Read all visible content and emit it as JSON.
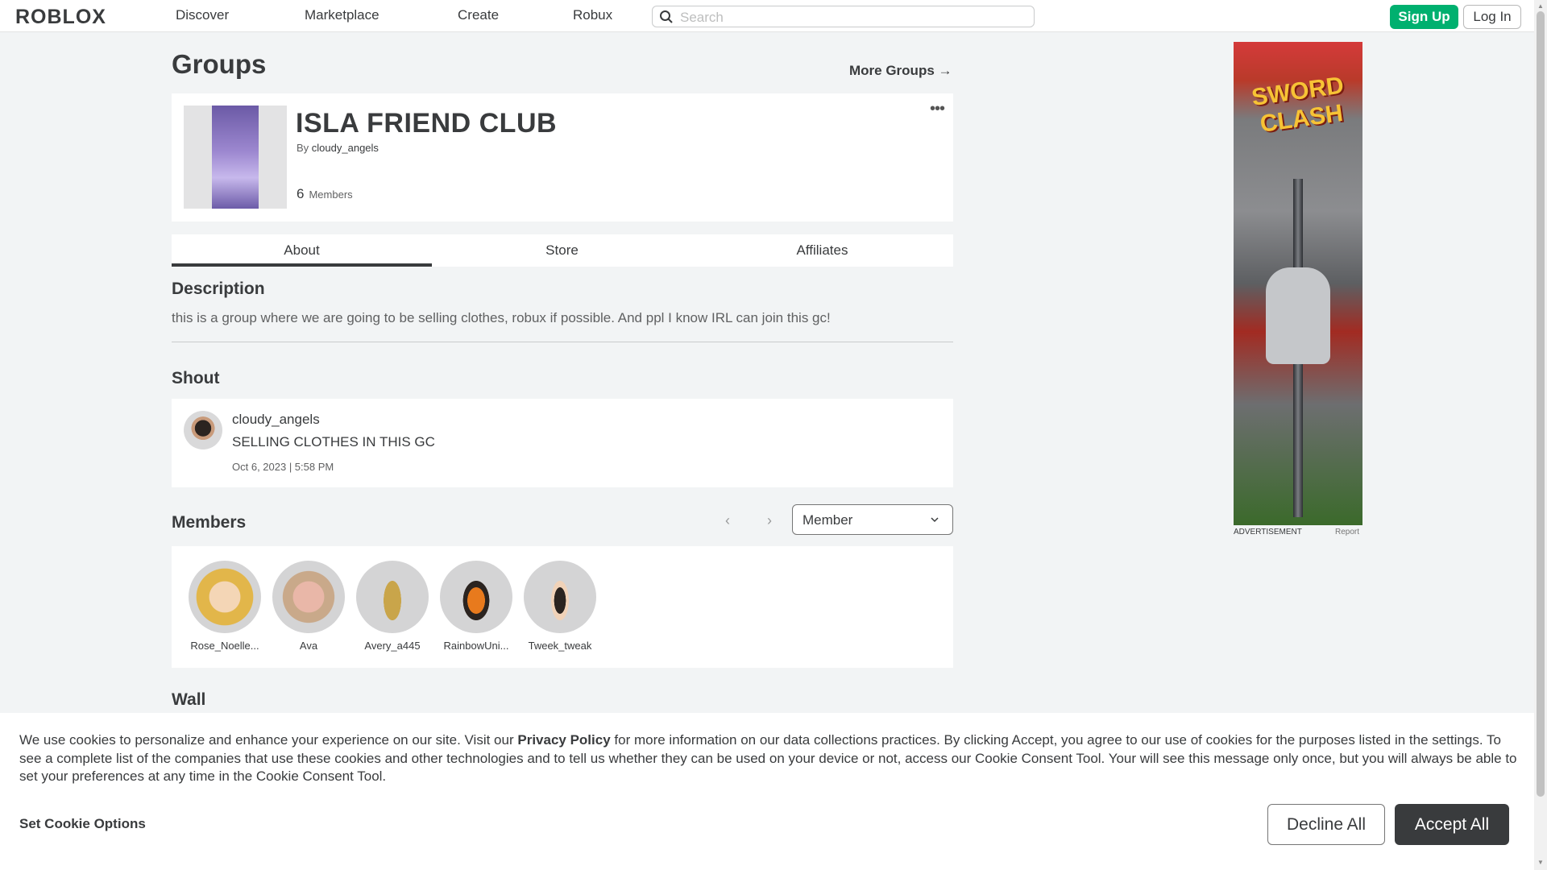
{
  "nav": {
    "logo": "ROBLOX",
    "links": [
      "Discover",
      "Marketplace",
      "Create",
      "Robux"
    ],
    "search_placeholder": "Search",
    "signup": "Sign Up",
    "login": "Log In"
  },
  "page": {
    "title": "Groups",
    "more_groups": "More Groups →"
  },
  "group": {
    "name": "ISLA FRIEND CLUB",
    "by_prefix": "By",
    "owner": "cloudy_angels",
    "member_count": "6",
    "member_label": "Members",
    "menu_icon": "ellipsis-icon"
  },
  "tabs": [
    "About",
    "Store",
    "Affiliates"
  ],
  "description": {
    "heading": "Description",
    "text": "this is a group where we are going to be selling clothes, robux if possible. And ppl I know IRL can join this gc!"
  },
  "shout": {
    "heading": "Shout",
    "user": "cloudy_angels",
    "message": "SELLING CLOTHES IN THIS GC",
    "date": "Oct 6, 2023 | 5:58 PM"
  },
  "members": {
    "heading": "Members",
    "prev": "‹",
    "next": "›",
    "role_selected": "Member",
    "list": [
      "Rose_Noelle...",
      "Ava",
      "Avery_a445",
      "RainbowUni...",
      "Tweek_tweak"
    ]
  },
  "wall": {
    "heading": "Wall"
  },
  "ad": {
    "logo_text": "Sword Clash",
    "label": "ADVERTISEMENT",
    "report": "Report"
  },
  "cookie": {
    "text_before": "We use cookies to personalize and enhance your experience on our site. Visit our ",
    "privacy_link": "Privacy Policy",
    "text_after": " for more information on our data collections practices. By clicking Accept, you agree to our use of cookies for the purposes listed in the settings. To see a complete list of the companies that use these cookies and other technologies and to tell us whether they can be used on your device or not, access our Cookie Consent Tool. Your will see this message only once, but you will always be able to set your preferences at any time in the Cookie Consent Tool.",
    "options": "Set Cookie Options",
    "decline": "Decline All",
    "accept": "Accept All"
  },
  "colors": {
    "accent_green": "#00b06f",
    "text": "#393b3d",
    "background": "#f2f4f5"
  }
}
